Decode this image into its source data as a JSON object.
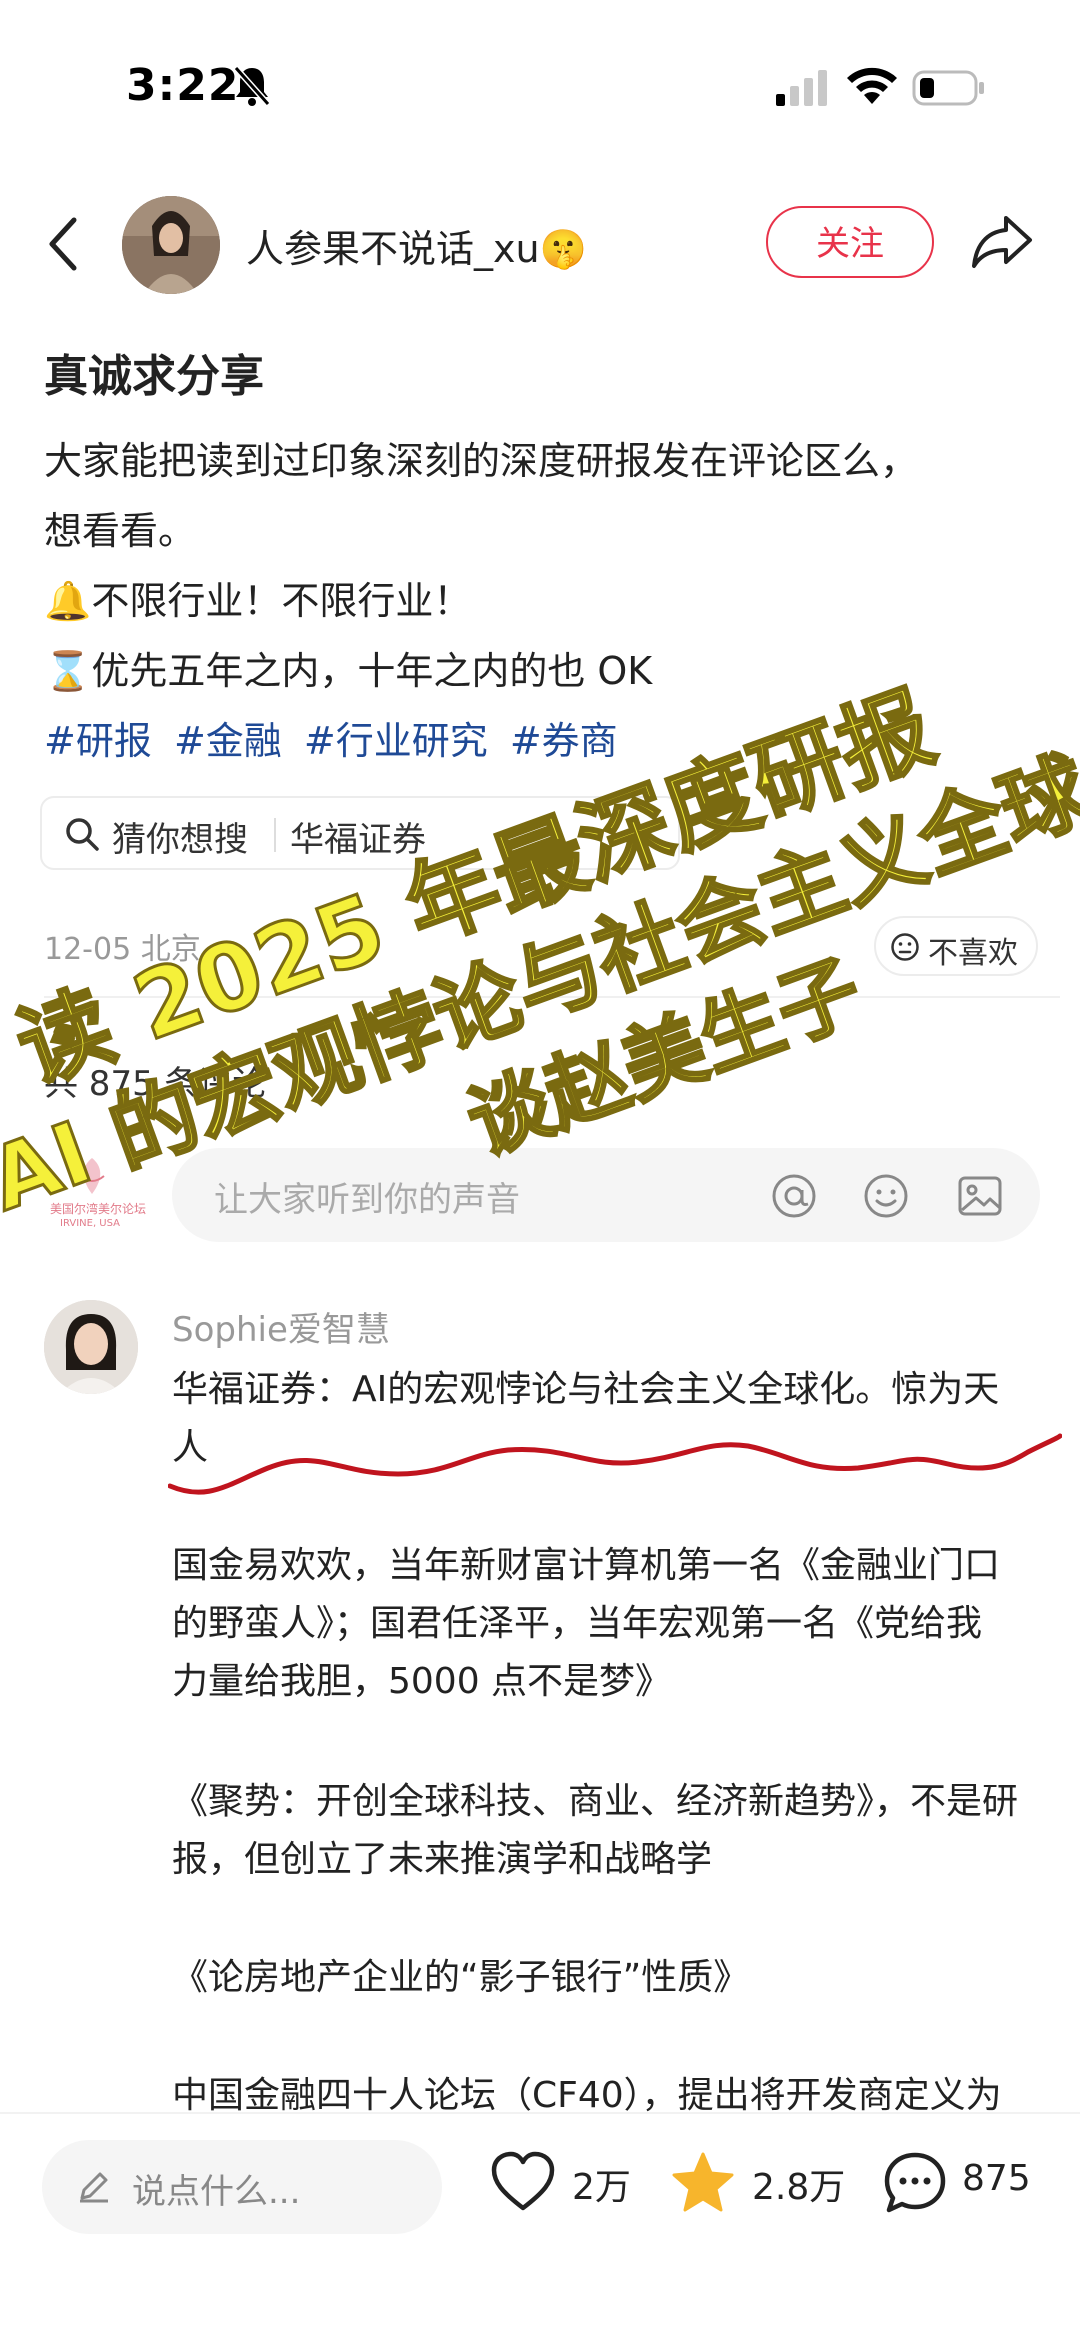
{
  "status_bar": {
    "time": "3:22"
  },
  "header": {
    "author_name": "人参果不说话_xu🤫",
    "follow_label": "关注"
  },
  "post": {
    "title": "真诚求分享",
    "body_lines": [
      "大家能把读到过印象深刻的深度研报发在评论区么，",
      "想看看。",
      "🔔不限行业！不限行业！",
      "⌛优先五年之内，十年之内的也 OK"
    ],
    "tags": [
      "#研报",
      "#金融",
      "#行业研究",
      "#券商"
    ],
    "search_suggestion": {
      "label": "猜你想搜",
      "query": "华福证券"
    },
    "meta_date": "12-05 北京",
    "dislike_label": "不喜欢",
    "comment_count_label": "共 875 条评论"
  },
  "comment_input": {
    "placeholder": "让大家听到你的声音",
    "avatar_text_line1": "美国尔湾美尔论坛",
    "avatar_text_line2": "IRVINE, USA"
  },
  "overlay": {
    "line1": "读 2025 年最深度研报",
    "line2": "AI 的宏观悖论与社会主义全球化",
    "line3": "谈赵美生子"
  },
  "comments": [
    {
      "author": "Sophie爱智慧",
      "lines": [
        "华福证券：AI的宏观悖论与社会主义全球化。惊为天",
        "人",
        "",
        "国金易欢欢，当年新财富计算机第一名《金融业门口",
        "的野蛮人》；国君任泽平，当年宏观第一名《党给我",
        "力量给我胆，5000 点不是梦》",
        "",
        "《聚势：开创全球科技、商业、经济新趋势》，不是研",
        "报，但创立了未来推演学和战略学",
        "",
        "《论房地产企业的“影子银行”性质》",
        "",
        "中国金融四十人论坛（CF40），提出将开发商定义为"
      ]
    }
  ],
  "bottom_bar": {
    "input_placeholder": "说点什么...",
    "likes": "2万",
    "favorites": "2.8万",
    "comments": "875"
  },
  "colors": {
    "accent_red": "#e8334a",
    "tag_blue": "#1f4a96",
    "overlay_yellow": "#f5f03a",
    "star_orange": "#f7b52c"
  }
}
